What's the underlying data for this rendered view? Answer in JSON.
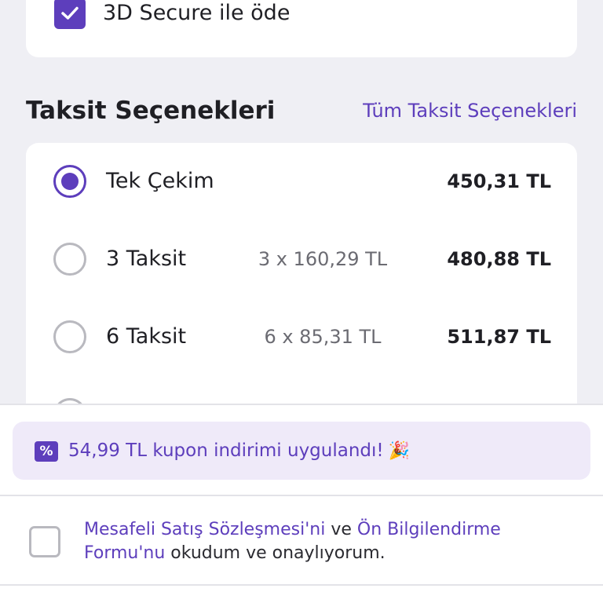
{
  "secure3d": {
    "label": "3D Secure ile öde",
    "checked": true
  },
  "installments": {
    "title": "Taksit Seçenekleri",
    "all_link": "Tüm Taksit Seçenekleri",
    "options": [
      {
        "name": "Tek Çekim",
        "per": "",
        "total": "450,31 TL",
        "selected": true
      },
      {
        "name": "3 Taksit",
        "per": "3 x 160,29 TL",
        "total": "480,88 TL",
        "selected": false
      },
      {
        "name": "6 Taksit",
        "per": "6 x 85,31 TL",
        "total": "511,87 TL",
        "selected": false
      }
    ]
  },
  "coupon": {
    "icon_text": "%",
    "text": "54,99 TL kupon indirimi uygulandı!",
    "emoji": "🎉",
    "icon": "percent-tag-icon"
  },
  "agreement": {
    "link1": "Mesafeli Satış Sözleşmesi'ni",
    "connector": " ve ",
    "link2": "Ön Bilgilendirme Formu'nu",
    "suffix": " okudum ve onaylıyorum.",
    "checked": false
  },
  "colors": {
    "accent": "#5d3ebc",
    "background": "#efeff4",
    "coupon_bg": "#efeaf9"
  }
}
